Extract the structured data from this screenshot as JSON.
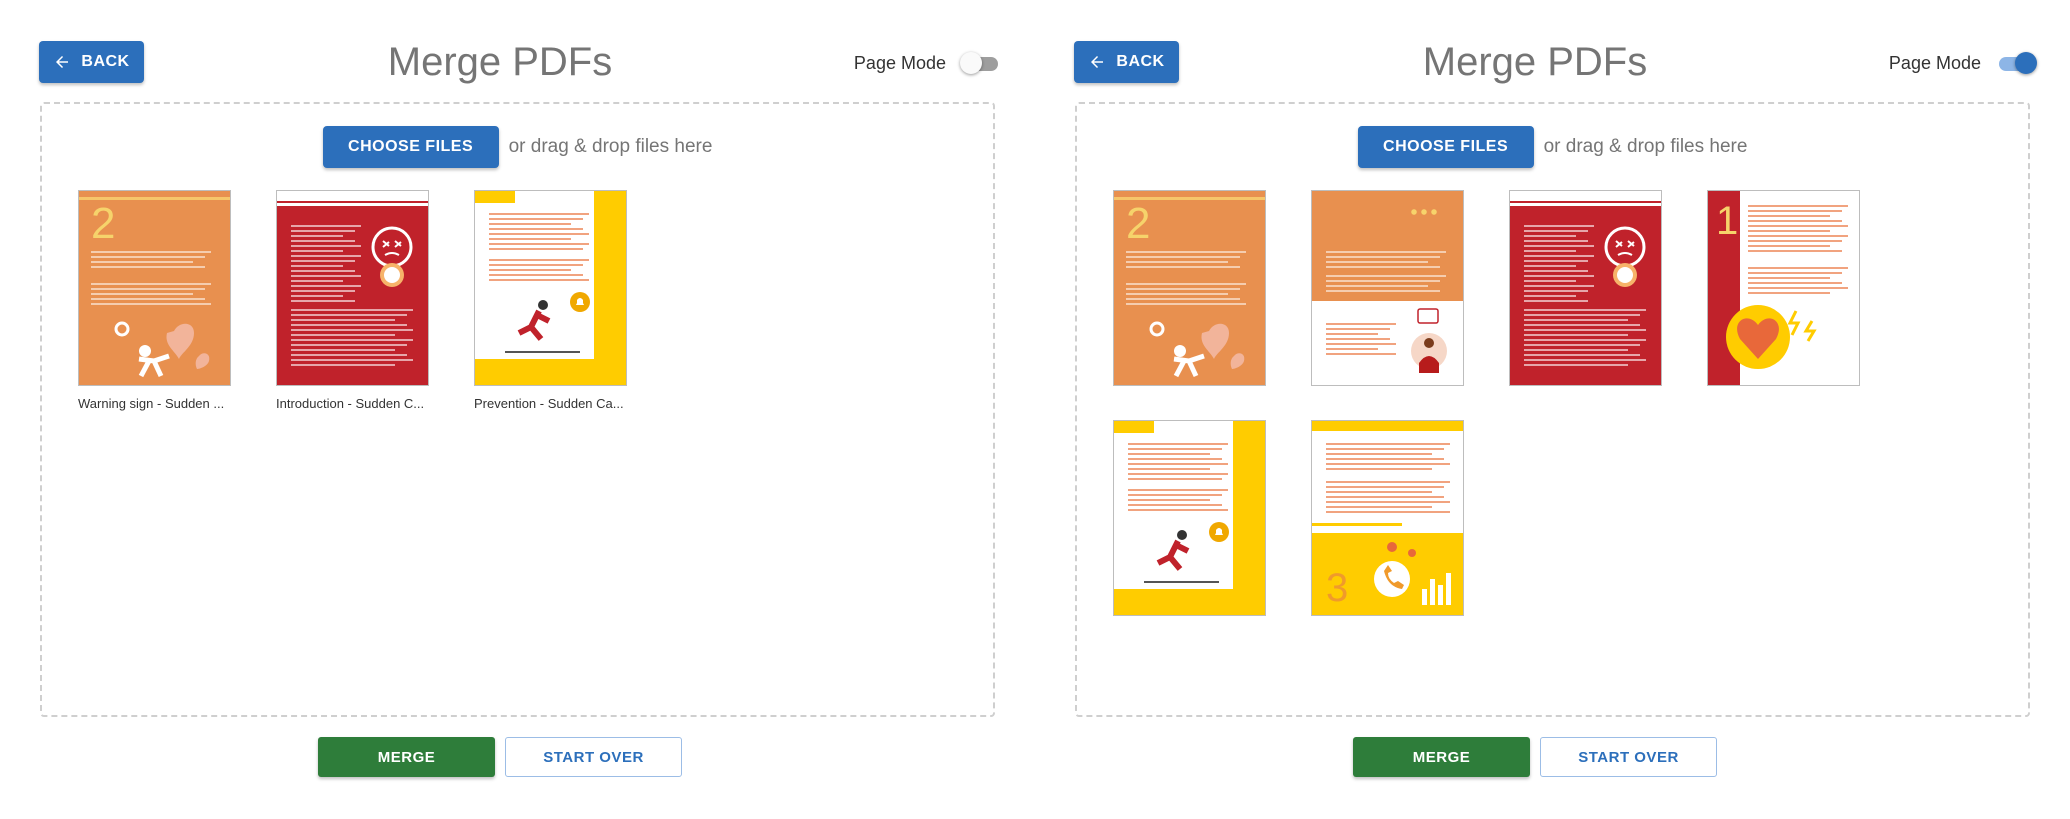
{
  "colors": {
    "primary": "#2c6fbb",
    "success": "#2e7d3a",
    "title": "#757575",
    "orange": "#e8904f",
    "red": "#c0222b",
    "yellow": "#ffcc00"
  },
  "left": {
    "back_label": "BACK",
    "title": "Merge PDFs",
    "page_mode_label": "Page Mode",
    "page_mode_on": false,
    "choose_files_label": "CHOOSE FILES",
    "drop_hint": "or drag & drop files here",
    "files": [
      {
        "label": "Warning sign - Sudden ...",
        "style": "orange-2"
      },
      {
        "label": "Introduction - Sudden C...",
        "style": "red-intro"
      },
      {
        "label": "Prevention - Sudden Ca...",
        "style": "yellow-prev"
      }
    ],
    "merge_label": "MERGE",
    "start_over_label": "START OVER"
  },
  "right": {
    "back_label": "BACK",
    "title": "Merge PDFs",
    "page_mode_label": "Page Mode",
    "page_mode_on": true,
    "choose_files_label": "CHOOSE FILES",
    "drop_hint": "or drag & drop files here",
    "pages": [
      {
        "style": "orange-2"
      },
      {
        "style": "orange-white"
      },
      {
        "style": "red-intro"
      },
      {
        "style": "red-1"
      },
      {
        "style": "yellow-prev"
      },
      {
        "style": "yellow-3"
      }
    ],
    "merge_label": "MERGE",
    "start_over_label": "START OVER"
  }
}
